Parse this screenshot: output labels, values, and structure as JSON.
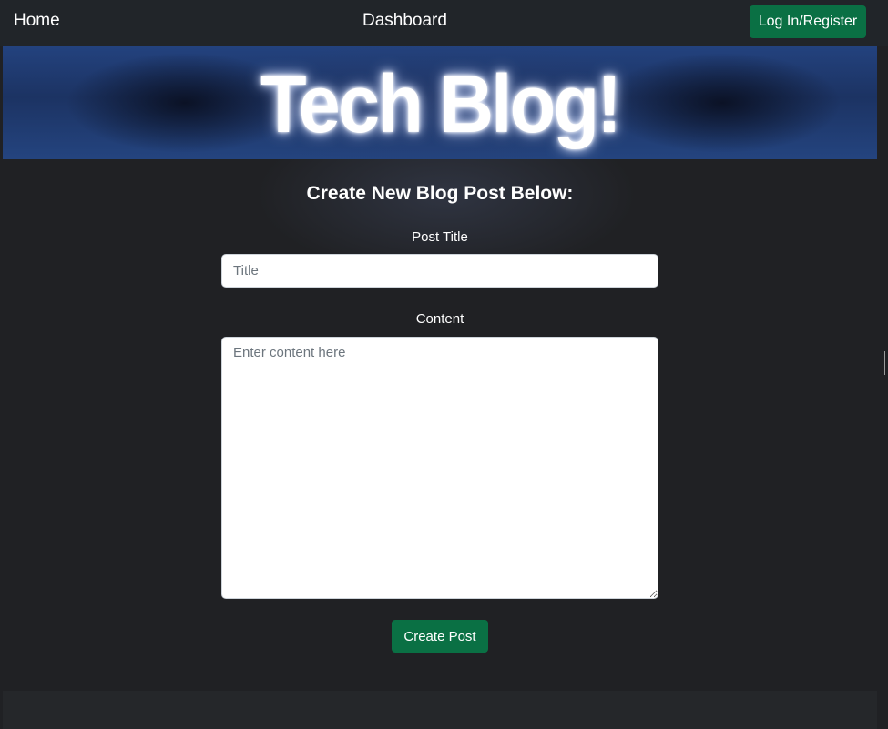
{
  "navbar": {
    "home_label": "Home",
    "dashboard_label": "Dashboard",
    "login_label": "Log In/Register"
  },
  "banner": {
    "title": "Tech Blog!"
  },
  "form": {
    "heading": "Create New Blog Post Below:",
    "title_label": "Post Title",
    "title_placeholder": "Title",
    "title_value": "",
    "content_label": "Content",
    "content_placeholder": "Enter content here",
    "content_value": "",
    "submit_label": "Create Post"
  },
  "colors": {
    "background": "#202124",
    "navbar": "#212529",
    "accent_green": "#0a7044",
    "banner_blue": "#23427e"
  }
}
